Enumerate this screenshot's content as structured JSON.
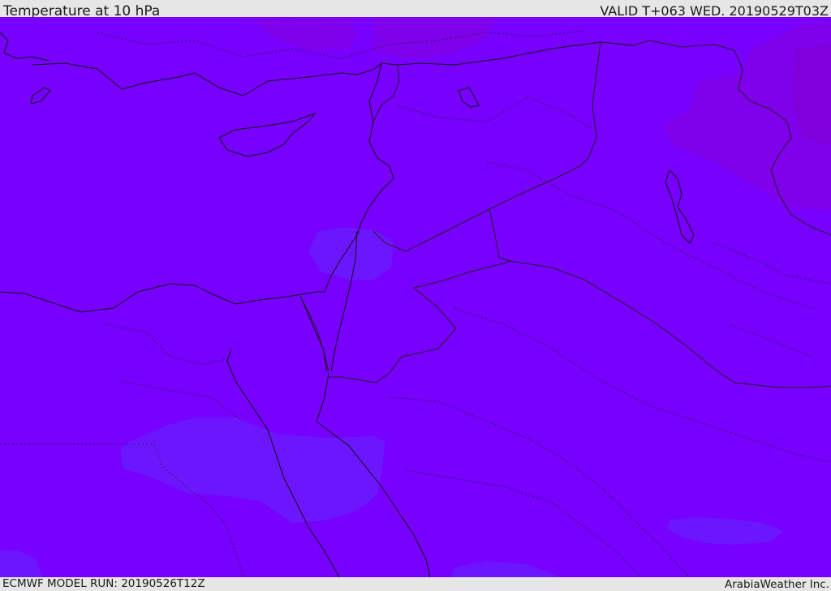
{
  "header": {
    "title": "Temperature at 10 hPa",
    "valid_time": "VALID T+063 WED. 20190529T03Z"
  },
  "footer": {
    "model_run": "ECMWF MODEL RUN: 20190526T12Z",
    "credit": "ArabiaWeather Inc."
  },
  "map": {
    "colors": {
      "background_field": "#7700ff",
      "warmer_field": "#7f00e8",
      "warmest_field": "#8000d8",
      "cooler_field": "#6a1aff",
      "coast_line": "#111111",
      "border_line": "#222222"
    },
    "layers": [
      "temperature-fill",
      "coastlines",
      "country-borders",
      "admin-boundaries"
    ]
  }
}
